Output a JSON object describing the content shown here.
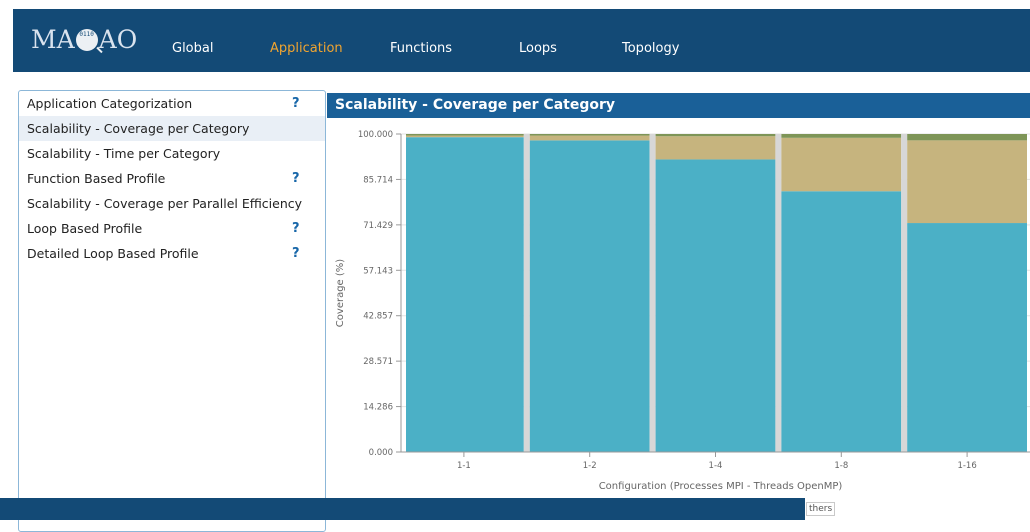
{
  "brand": {
    "logo_left": "MA",
    "logo_glyph": "0110",
    "logo_right": "AO"
  },
  "nav": {
    "items": [
      {
        "label": "Global",
        "active": false
      },
      {
        "label": "Application",
        "active": true
      },
      {
        "label": "Functions",
        "active": false
      },
      {
        "label": "Loops",
        "active": false
      },
      {
        "label": "Topology",
        "active": false
      }
    ]
  },
  "sidebar": {
    "items": [
      {
        "label": "Application Categorization",
        "help": "?"
      },
      {
        "label": "Scalability - Coverage per Category",
        "help": ""
      },
      {
        "label": "Scalability - Time per Category",
        "help": ""
      },
      {
        "label": "Function Based Profile",
        "help": "?"
      },
      {
        "label": "Scalability - Coverage per Parallel Efficiency",
        "help": ""
      },
      {
        "label": "Loop Based Profile",
        "help": "?"
      },
      {
        "label": "Detailed Loop Based Profile",
        "help": "?"
      }
    ]
  },
  "panel": {
    "title": "Scalability - Coverage per Category"
  },
  "footer": {
    "others_label": "thers"
  },
  "colors": {
    "teal": "#4bb0c6",
    "tan": "#c6b47e",
    "olive": "#7e9557",
    "nav_active": "#f0a430",
    "header_bg": "#134a76"
  },
  "chart_data": {
    "type": "bar",
    "stacked": true,
    "title": "",
    "xlabel": "Configuration (Processes MPI - Threads OpenMP)",
    "ylabel": "Coverage (%)",
    "ylim": [
      0,
      100
    ],
    "yticks": [
      "0.000",
      "14.286",
      "28.571",
      "42.857",
      "57.143",
      "71.429",
      "85.714",
      "100.000"
    ],
    "categories": [
      "1-1",
      "1-2",
      "1-4",
      "1-8",
      "1-16"
    ],
    "series": [
      {
        "color": "#4bb0c6",
        "values": [
          99.0,
          98.0,
          92.0,
          82.0,
          72.0
        ]
      },
      {
        "color": "#c6b47e",
        "values": [
          0.5,
          1.5,
          7.3,
          16.8,
          26.0
        ]
      },
      {
        "color": "#7e9557",
        "values": [
          0.5,
          0.5,
          0.7,
          1.2,
          2.0
        ]
      }
    ],
    "grid": true
  }
}
